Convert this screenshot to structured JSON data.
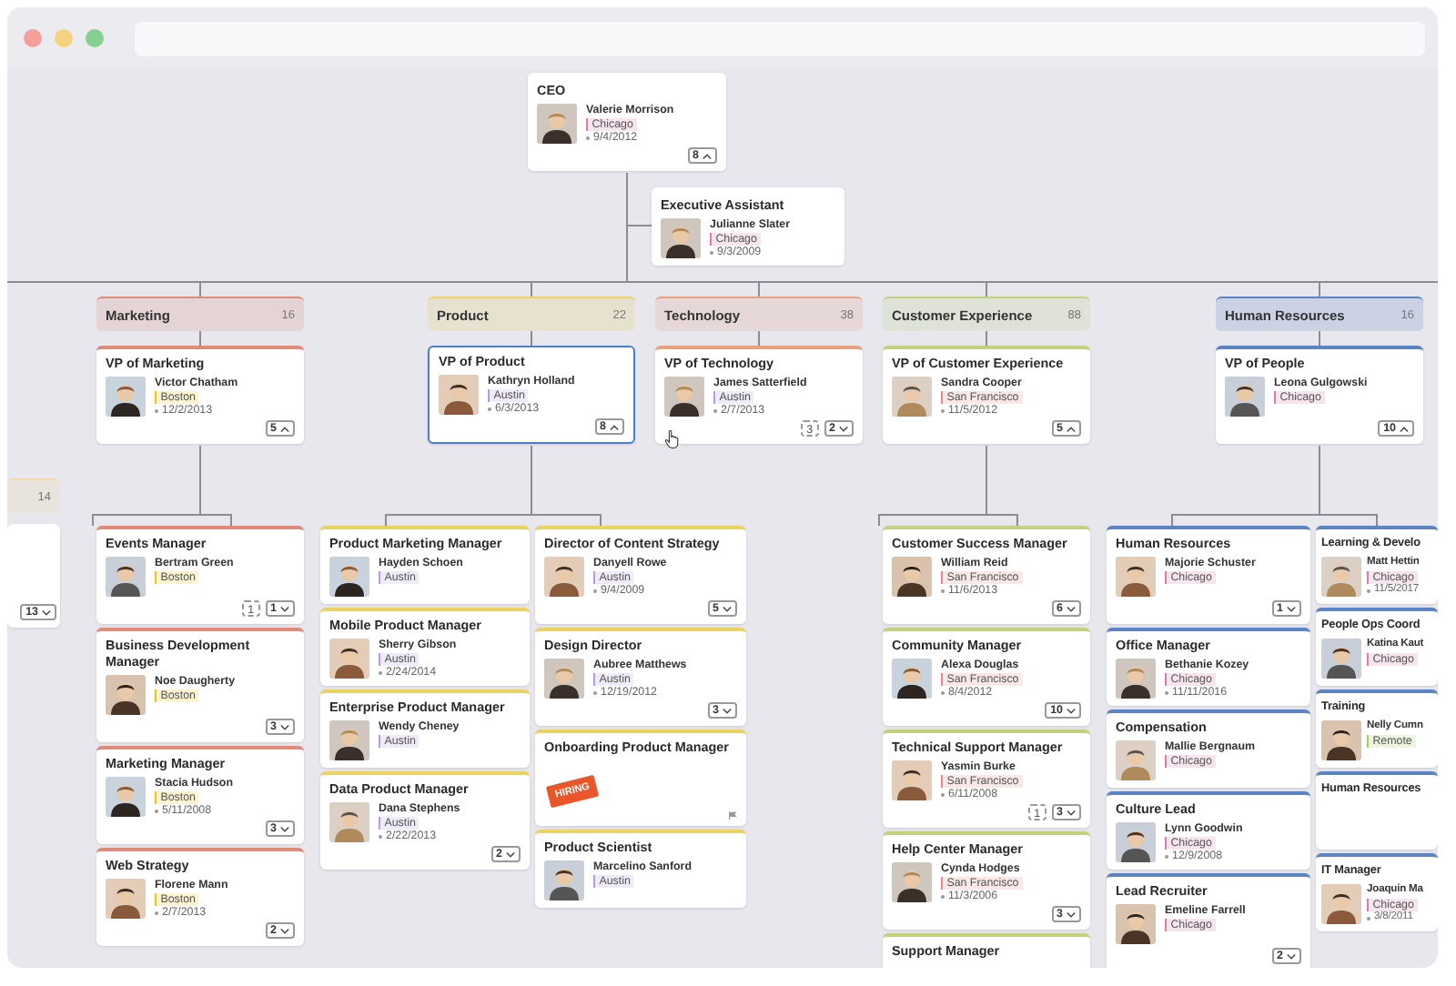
{
  "ceo": {
    "kind": "person",
    "title": "CEO",
    "name": "Valerie Morrison",
    "location": "Chicago",
    "color": "#d97fa3",
    "date": "9/4/2012",
    "reports": "8",
    "expanded": true,
    "selected": false
  },
  "assistant": {
    "kind": "person",
    "title": "Executive Assistant",
    "name": "Julianne Slater",
    "location": "Chicago",
    "color": "#d97fa3",
    "date": "9/3/2009",
    "selected": false
  },
  "offscreen_department": {
    "count": "14",
    "color": "#f5d9a6",
    "reports": "13",
    "expanded": false
  },
  "departments": [
    {
      "name": "Marketing",
      "count": "16",
      "color": "#e08a7a",
      "vp": {
        "kind": "person",
        "title": "VP of Marketing",
        "name": "Victor Chatham",
        "location": "Boston",
        "color": "#f0c419",
        "date": "12/2/2013",
        "reports": "5",
        "expanded": true,
        "selected": false
      },
      "columns": [
        {
          "cards": [
            {
              "kind": "person",
              "title": "Events Manager",
              "name": "Bertram Green",
              "location": "Boston",
              "color": "#f0c419",
              "vacancies": "1",
              "reports": "1",
              "expanded": false,
              "selected": false
            },
            {
              "kind": "person",
              "title": "Business Development Manager",
              "name": "Noe Daugherty",
              "location": "Boston",
              "color": "#f0c419",
              "reports": "3",
              "expanded": false,
              "selected": false
            },
            {
              "kind": "person",
              "title": "Marketing Manager",
              "name": "Stacia Hudson",
              "location": "Boston",
              "color": "#f0c419",
              "date": "5/11/2008",
              "reports": "3",
              "expanded": false,
              "selected": false
            },
            {
              "kind": "person",
              "title": "Web Strategy",
              "name": "Florene Mann",
              "location": "Boston",
              "color": "#f0c419",
              "date": "2/7/2013",
              "reports": "2",
              "expanded": false,
              "selected": false
            }
          ]
        }
      ]
    },
    {
      "name": "Product",
      "count": "22",
      "color": "#ecd25e",
      "vp": {
        "kind": "person",
        "title": "VP of Product",
        "name": "Kathryn Holland",
        "location": "Austin",
        "color": "#b49ddc",
        "date": "6/3/2013",
        "reports": "8",
        "expanded": true,
        "selected": true
      },
      "columns": [
        {
          "cards": [
            {
              "kind": "person",
              "title": "Product Marketing Manager",
              "name": "Hayden Schoen",
              "location": "Austin",
              "color": "#b49ddc",
              "selected": false
            },
            {
              "kind": "person",
              "title": "Mobile Product Manager",
              "name": "Sherry Gibson",
              "location": "Austin",
              "color": "#b49ddc",
              "date": "2/24/2014",
              "selected": false
            },
            {
              "kind": "person",
              "title": "Enterprise Product Manager",
              "name": "Wendy Cheney",
              "location": "Austin",
              "color": "#b49ddc",
              "selected": false
            },
            {
              "kind": "person",
              "title": "Data Product Manager",
              "name": "Dana Stephens",
              "location": "Austin",
              "color": "#b49ddc",
              "date": "2/22/2013",
              "reports": "2",
              "expanded": false,
              "selected": false
            }
          ]
        },
        {
          "cards": [
            {
              "kind": "person",
              "title": "Director of Content Strategy",
              "name": "Danyell Rowe",
              "location": "Austin",
              "color": "#b49ddc",
              "date": "9/4/2009",
              "reports": "5",
              "expanded": false,
              "selected": false
            },
            {
              "kind": "person",
              "title": "Design Director",
              "name": "Aubree Matthews",
              "location": "Austin",
              "color": "#b49ddc",
              "date": "12/19/2012",
              "reports": "3",
              "expanded": false,
              "selected": false
            },
            {
              "kind": "vacancy",
              "title": "Onboarding Product Manager",
              "sign": "HIRING",
              "selected": false
            },
            {
              "kind": "person",
              "title": "Product Scientist",
              "name": "Marcelino Sanford",
              "location": "Austin",
              "color": "#b49ddc",
              "selected": false
            }
          ]
        }
      ]
    },
    {
      "name": "Technology",
      "count": "38",
      "color": "#e8a27e",
      "vp": {
        "kind": "person",
        "title": "VP of Technology",
        "name": "James Satterfield",
        "location": "Austin",
        "color": "#b49ddc",
        "date": "2/7/2013",
        "vacancies": "3",
        "reports": "2",
        "expanded": false,
        "selected": false
      }
    },
    {
      "name": "Customer Experience",
      "count": "88",
      "color": "#c3d27c",
      "vp": {
        "kind": "person",
        "title": "VP of Customer Experience",
        "name": "Sandra Cooper",
        "location": "San Francisco",
        "color": "#e88a8a",
        "date": "11/5/2012",
        "reports": "5",
        "expanded": true,
        "selected": false
      },
      "columns": [
        {
          "cards": [
            {
              "kind": "person",
              "title": "Customer Success Manager",
              "name": "William Reid",
              "location": "San Francisco",
              "color": "#e88a8a",
              "date": "11/6/2013",
              "reports": "6",
              "expanded": false,
              "selected": false
            },
            {
              "kind": "person",
              "title": "Community Manager",
              "name": "Alexa Douglas",
              "location": "San Francisco",
              "color": "#e88a8a",
              "date": "8/4/2012",
              "reports": "10",
              "expanded": false,
              "selected": false
            },
            {
              "kind": "person",
              "title": "Technical Support Manager",
              "name": "Yasmin Burke",
              "location": "San Francisco",
              "color": "#e88a8a",
              "date": "6/11/2008",
              "vacancies": "1",
              "reports": "3",
              "expanded": false,
              "selected": false
            },
            {
              "kind": "person",
              "title": "Help Center Manager",
              "name": "Cynda Hodges",
              "location": "San Francisco",
              "color": "#e88a8a",
              "date": "11/3/2006",
              "reports": "3",
              "expanded": false,
              "selected": false
            },
            {
              "kind": "blank",
              "title": "Support Manager",
              "selected": false
            }
          ]
        }
      ]
    },
    {
      "name": "Human Resources",
      "count": "16",
      "color": "#5b84c4",
      "vp": {
        "kind": "person",
        "title": "VP of People",
        "name": "Leona Gulgowski",
        "location": "Chicago",
        "color": "#d97fa3",
        "reports": "10",
        "expanded": true,
        "selected": false
      },
      "columns": [
        {
          "cards": [
            {
              "kind": "person",
              "title": "Human Resources",
              "name": "Majorie Schuster",
              "location": "Chicago",
              "color": "#d97fa3",
              "reports": "1",
              "expanded": false,
              "selected": false
            },
            {
              "kind": "person",
              "title": "Office Manager",
              "name": "Bethanie Kozey",
              "location": "Chicago",
              "color": "#d97fa3",
              "date": "11/11/2016",
              "selected": false
            },
            {
              "kind": "person",
              "title": "Compensation",
              "name": "Mallie Bergnaum",
              "location": "Chicago",
              "color": "#d97fa3",
              "selected": false
            },
            {
              "kind": "person",
              "title": "Culture Lead",
              "name": "Lynn Goodwin",
              "location": "Chicago",
              "color": "#d97fa3",
              "date": "12/9/2008",
              "selected": false
            },
            {
              "kind": "person",
              "title": "Lead Recruiter",
              "name": "Emeline Farrell",
              "location": "Chicago",
              "color": "#d97fa3",
              "reports": "2",
              "expanded": false,
              "selected": false
            }
          ]
        },
        {
          "cards": [
            {
              "kind": "person",
              "title": "Learning & Develo",
              "name": "Matt Hettin",
              "location": "Chicago",
              "color": "#d97fa3",
              "date": "11/5/2017",
              "selected": false
            },
            {
              "kind": "person",
              "title": "People Ops Coord",
              "name": "Katina Kaut",
              "location": "Chicago",
              "color": "#d97fa3",
              "selected": false
            },
            {
              "kind": "person",
              "title": "Training",
              "name": "Nelly Cumn",
              "location": "Remote",
              "color": "#a5cf5e",
              "selected": false
            },
            {
              "kind": "blank",
              "title": "Human Resources",
              "selected": false
            },
            {
              "kind": "person",
              "title": "IT Manager",
              "name": "Joaquin Ma",
              "location": "Chicago",
              "color": "#d97fa3",
              "date": "3/8/2011",
              "selected": false
            }
          ]
        }
      ]
    }
  ]
}
